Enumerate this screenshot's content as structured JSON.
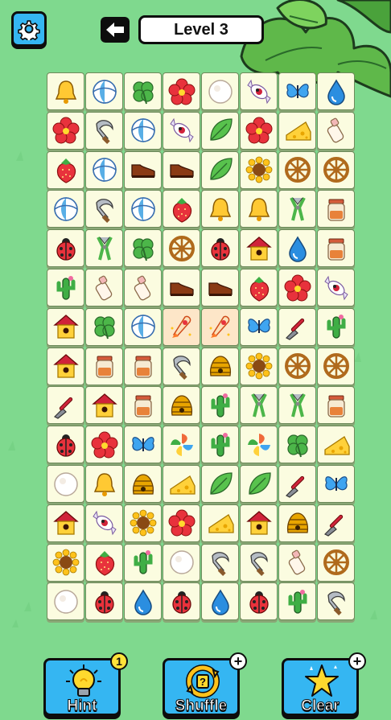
{
  "header": {
    "settings_icon": "gear-icon",
    "back_icon": "back-arrow-icon",
    "level_label": "Level 3"
  },
  "board": {
    "columns": 8,
    "rows": 14,
    "tiles": [
      [
        "bell",
        "beachball",
        "clover",
        "flower",
        "snowball",
        "candy",
        "butterfly",
        "drop"
      ],
      [
        "flower",
        "sickle",
        "beachball",
        "candy",
        "leaf",
        "flower",
        "cheese",
        "bottle"
      ],
      [
        "strawberry",
        "beachball",
        "shoe",
        "shoe",
        "leaf",
        "sunflower",
        "wheel",
        "wheel"
      ],
      [
        "beachball",
        "sickle",
        "beachball",
        "strawberry",
        "bell",
        "bell",
        "pliers",
        "jar"
      ],
      [
        "ladybug",
        "pliers",
        "clover",
        "wheel",
        "ladybug",
        "birdhouse",
        "drop",
        "jar"
      ],
      [
        "cactus",
        "bottle",
        "bottle",
        "shoe",
        "shoe",
        "strawberry",
        "flower",
        "candy"
      ],
      [
        "birdhouse",
        "clover",
        "beachball",
        "rocket",
        "rocket",
        "butterfly",
        "spatula",
        "cactus"
      ],
      [
        "birdhouse",
        "jar",
        "jar",
        "sickle",
        "beehive",
        "sunflower",
        "wheel",
        "wheel"
      ],
      [
        "spatula",
        "birdhouse",
        "jar",
        "beehive",
        "cactus",
        "pliers",
        "pliers",
        "jar"
      ],
      [
        "ladybug",
        "flower",
        "butterfly",
        "pinwheel",
        "cactus",
        "pinwheel",
        "clover",
        "cheese"
      ],
      [
        "snowball",
        "bell",
        "beehive",
        "cheese",
        "leaf",
        "leaf",
        "spatula",
        "butterfly"
      ],
      [
        "birdhouse",
        "candy",
        "sunflower",
        "flower",
        "cheese",
        "birdhouse",
        "beehive",
        "spatula"
      ],
      [
        "sunflower",
        "strawberry",
        "cactus",
        "snowball",
        "sickle",
        "sickle",
        "bottle",
        "wheel"
      ],
      [
        "snowball",
        "ladybug",
        "drop",
        "ladybug",
        "drop",
        "ladybug",
        "cactus",
        "sickle"
      ]
    ],
    "selected": [
      [
        6,
        3
      ],
      [
        6,
        4
      ]
    ]
  },
  "powerups": {
    "hint": {
      "label": "Hint",
      "icon": "lightbulb-icon",
      "count": "1"
    },
    "shuffle": {
      "label": "Shuffle",
      "icon": "shuffle-icon",
      "badge": "+"
    },
    "clear": {
      "label": "Clear",
      "icon": "star-icon",
      "badge": "+"
    }
  },
  "colors": {
    "background": "#7fd98e",
    "button": "#35b6f2",
    "tile": "#fbfce0"
  }
}
